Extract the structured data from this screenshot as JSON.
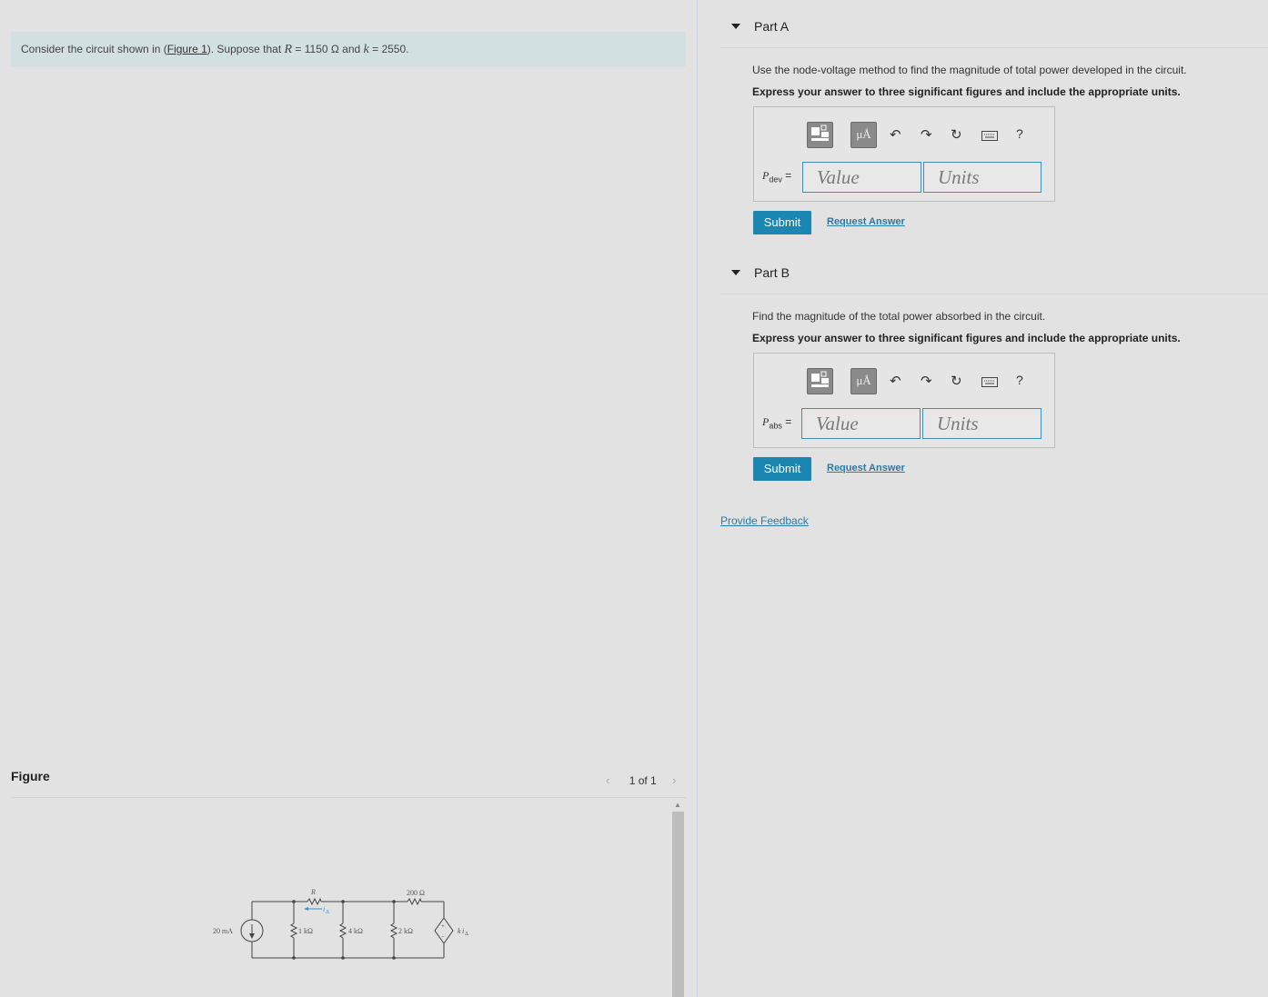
{
  "problem": {
    "text_before": "Consider the circuit shown in (",
    "figure_link": "Figure 1",
    "text_mid": "). Suppose that ",
    "r_var": "R",
    "r_eq": " = 1150  Ω and ",
    "k_var": "k",
    "k_eq": " = 2550."
  },
  "figure": {
    "title": "Figure",
    "pager": "1 of 1",
    "labels": {
      "source": "20 mA",
      "r": "R",
      "i_delta": "i",
      "i_sub": "Δ",
      "r1": "1 kΩ",
      "r2": "4 kΩ",
      "r3": "2 kΩ",
      "r4": "200 Ω",
      "dep_k": "k",
      "dep_i": "i",
      "dep_sub": "Δ",
      "plus": "+",
      "minus": "−"
    }
  },
  "toolbar": {
    "units_btn": "μÅ",
    "help": "?"
  },
  "parts": [
    {
      "title": "Part A",
      "question": "Use the node-voltage method to find the magnitude of total power developed in the circuit.",
      "instruction": "Express your answer to three significant figures and include the appropriate units.",
      "var": "P",
      "var_sub": "dev",
      "eq": " =",
      "value_placeholder": "Value",
      "units_placeholder": "Units",
      "submit": "Submit",
      "request": "Request Answer"
    },
    {
      "title": "Part B",
      "question": "Find the magnitude of the total power absorbed in the circuit.",
      "instruction": "Express your answer to three significant figures and include the appropriate units.",
      "var": "P",
      "var_sub": "abs",
      "eq": " =",
      "value_placeholder": "Value",
      "units_placeholder": "Units",
      "submit": "Submit",
      "request": "Request Answer"
    }
  ],
  "feedback": "Provide Feedback"
}
